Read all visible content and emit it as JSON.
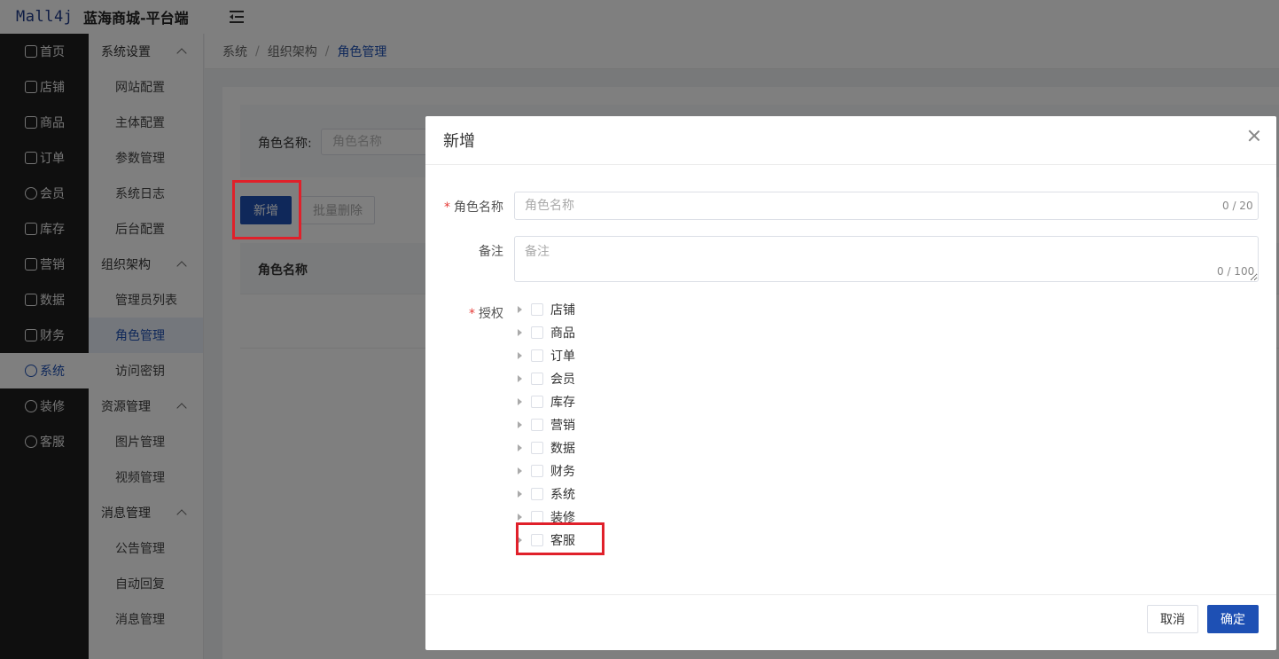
{
  "header": {
    "logo": "Mall4j",
    "platform_name": "蓝海商城-平台端"
  },
  "sidebar": {
    "items": [
      {
        "label": "首页",
        "icon": "home-icon",
        "active": false
      },
      {
        "label": "店铺",
        "icon": "shop-icon",
        "active": false
      },
      {
        "label": "商品",
        "icon": "product-icon",
        "active": false
      },
      {
        "label": "订单",
        "icon": "order-icon",
        "active": false
      },
      {
        "label": "会员",
        "icon": "member-icon",
        "active": false
      },
      {
        "label": "库存",
        "icon": "stock-icon",
        "active": false
      },
      {
        "label": "营销",
        "icon": "marketing-icon",
        "active": false
      },
      {
        "label": "数据",
        "icon": "data-icon",
        "active": false
      },
      {
        "label": "财务",
        "icon": "finance-icon",
        "active": false
      },
      {
        "label": "系统",
        "icon": "system-icon",
        "active": true
      },
      {
        "label": "装修",
        "icon": "decorate-icon",
        "active": false
      },
      {
        "label": "客服",
        "icon": "service-icon",
        "active": false
      }
    ]
  },
  "submenu": {
    "groups": [
      {
        "title": "系统设置",
        "items": [
          "网站配置",
          "主体配置",
          "参数管理",
          "系统日志",
          "后台配置"
        ]
      },
      {
        "title": "组织架构",
        "items": [
          "管理员列表",
          "角色管理",
          "访问密钥"
        ]
      },
      {
        "title": "资源管理",
        "items": [
          "图片管理",
          "视频管理"
        ]
      },
      {
        "title": "消息管理",
        "items": [
          "公告管理",
          "自动回复",
          "消息管理"
        ]
      }
    ],
    "active_item": "角色管理"
  },
  "breadcrumb": [
    "系统",
    "组织架构",
    "角色管理"
  ],
  "page": {
    "search_label": "角色名称:",
    "search_placeholder": "角色名称",
    "add_button": "新增",
    "batch_delete_button": "批量删除",
    "table_header": "角色名称"
  },
  "dialog": {
    "title": "新增",
    "role_name_label": "角色名称",
    "role_name_placeholder": "角色名称",
    "role_name_count": "0 / 20",
    "remark_label": "备注",
    "remark_placeholder": "备注",
    "remark_count": "0 / 100",
    "auth_label": "授权",
    "tree": [
      "店铺",
      "商品",
      "订单",
      "会员",
      "库存",
      "营销",
      "数据",
      "财务",
      "系统",
      "装修",
      "客服"
    ],
    "cancel_button": "取消",
    "confirm_button": "确定"
  },
  "colors": {
    "primary": "#1e50b4",
    "sidebar_bg": "#1f1f1f",
    "highlight": "#e0202a",
    "required": "#e53935"
  }
}
